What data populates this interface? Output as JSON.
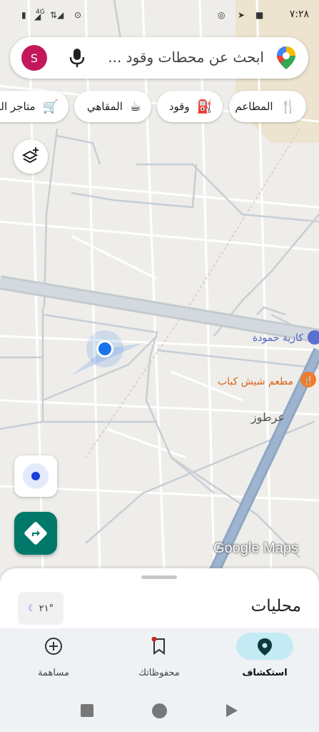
{
  "status_bar": {
    "time": "٧:٢٨",
    "signal_left": "4G"
  },
  "search": {
    "placeholder": "ابحث عن محطات وقود ...",
    "avatar_letter": "S"
  },
  "chips": [
    {
      "label": "المطاعم",
      "icon": "fork-knife-icon"
    },
    {
      "label": "وقود",
      "icon": "gas-station-icon"
    },
    {
      "label": "المقاهي",
      "icon": "coffee-cup-icon"
    },
    {
      "label": "متاجر البـ",
      "icon": "shopping-cart-icon"
    }
  ],
  "map_labels": {
    "poi1": "كازية حمودة",
    "poi2": "مطعم شيش كباب",
    "area": "عرطوز",
    "logo": "Google Maps"
  },
  "sheet": {
    "title": "محليات",
    "weather": "٢١°"
  },
  "nav": {
    "explore": "استكشاف",
    "saved": "محفوظاتك",
    "contribute": "مساهمة"
  },
  "colors": {
    "accent": "#00796b",
    "avatar": "#c2185b",
    "user_dot": "#1a73e8"
  }
}
